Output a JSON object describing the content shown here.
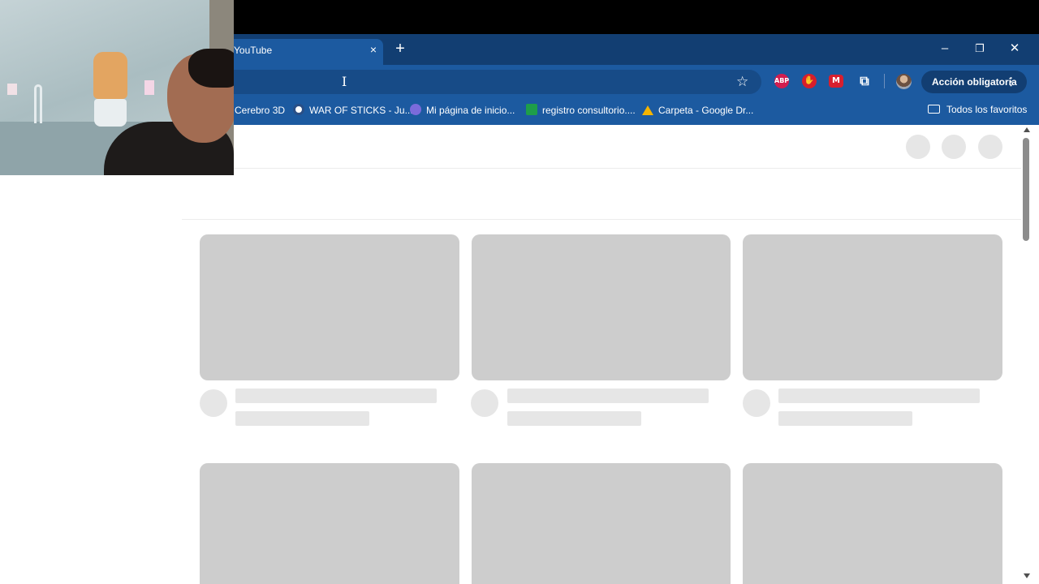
{
  "browser": {
    "tab": {
      "title": "YouTube",
      "close_icon": "×"
    },
    "new_tab_icon": "+",
    "window_controls": {
      "minimize": "–",
      "restore": "❐",
      "close": "✕"
    },
    "address_bar": {
      "value": "",
      "cursor_icon": "I"
    },
    "extensions": {
      "abp": "ABP",
      "hand": "✋",
      "m": "M",
      "puzzle": "⧉"
    },
    "action_button": {
      "label": "Acción obligatoria",
      "menu_icon": "⋮"
    },
    "bookmarks": [
      {
        "label": "Cerebro 3D",
        "icon_color": ""
      },
      {
        "label": "WAR OF STICKS - Ju...",
        "icon_color": "#ffffff"
      },
      {
        "label": "Mi página de inicio...",
        "icon_color": "#7b6bdb"
      },
      {
        "label": "registro consultorio....",
        "icon_color": "#1e9e4a"
      },
      {
        "label": "Carpeta - Google Dr...",
        "icon_color": "#f4b400"
      }
    ],
    "all_bookmarks_label": "Todos los favoritos"
  },
  "page": {
    "state": "loading skeleton",
    "accent": "#1c5aa0",
    "skeleton_color": "#cdcdcd"
  }
}
